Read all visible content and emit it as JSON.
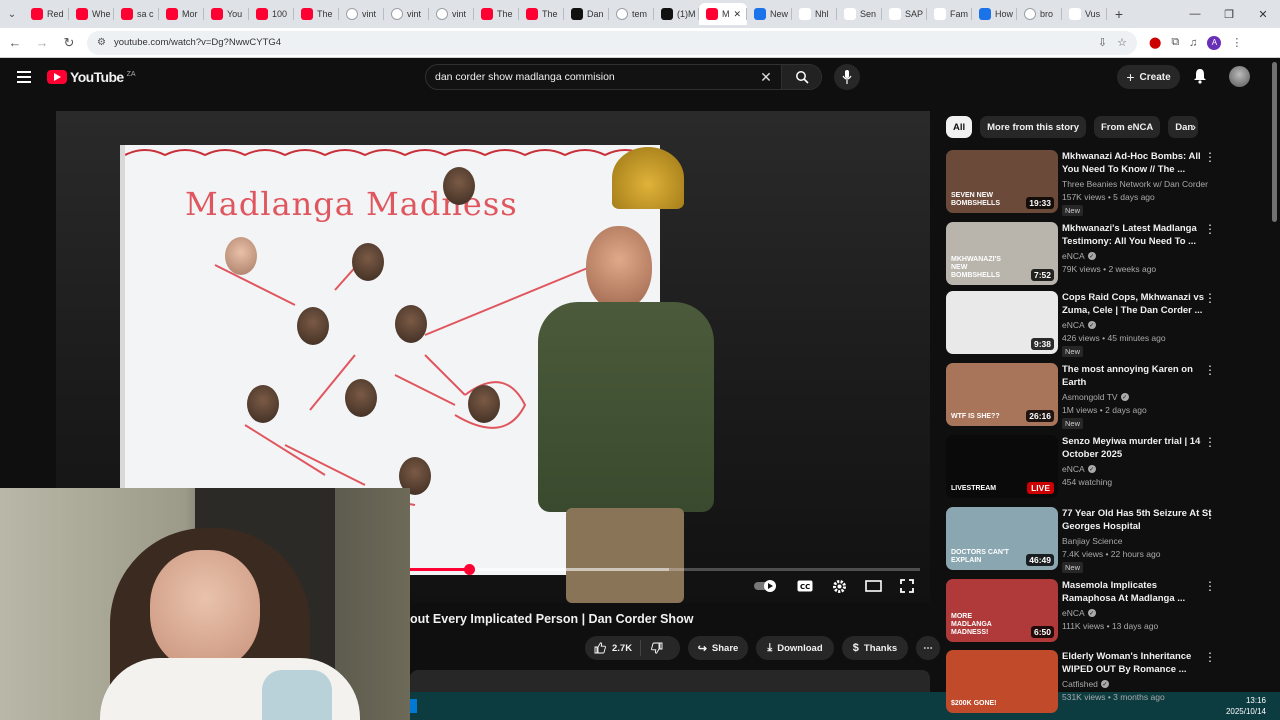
{
  "browser": {
    "tabs": [
      {
        "label": "Red",
        "icon": "yt"
      },
      {
        "label": "Whe",
        "icon": "yt"
      },
      {
        "label": "sa c",
        "icon": "yt"
      },
      {
        "label": "Mor",
        "icon": "yt"
      },
      {
        "label": "You",
        "icon": "yt"
      },
      {
        "label": "100",
        "icon": "yt"
      },
      {
        "label": "The",
        "icon": "yt"
      },
      {
        "label": "vint",
        "icon": "g"
      },
      {
        "label": "vint",
        "icon": "g"
      },
      {
        "label": "vint",
        "icon": "g"
      },
      {
        "label": "The",
        "icon": "yt"
      },
      {
        "label": "The",
        "icon": "yt"
      },
      {
        "label": "Dan",
        "icon": "tt"
      },
      {
        "label": "tem",
        "icon": "g"
      },
      {
        "label": "(1)M",
        "icon": "tt"
      },
      {
        "label": "M",
        "icon": "yt",
        "active": true
      },
      {
        "label": "New",
        "icon": "b"
      },
      {
        "label": "Nhl",
        "icon": "w"
      },
      {
        "label": "Sen",
        "icon": "w"
      },
      {
        "label": "SAP",
        "icon": "i"
      },
      {
        "label": "Fam",
        "icon": "w"
      },
      {
        "label": "How",
        "icon": "b"
      },
      {
        "label": "bro",
        "icon": "g"
      },
      {
        "label": "Vus",
        "icon": "w"
      }
    ],
    "url": "youtube.com/watch?v=Dg?NwwCYTG4",
    "profile_initial": "A"
  },
  "youtube": {
    "logo_text": "YouTube",
    "country_code": "ZA",
    "search_query": "dan corder show madlanga commision",
    "create_label": "Create"
  },
  "player": {
    "board_title": "Madlanga Madness",
    "progress_fraction": 0.12,
    "buffered_fraction": 0.51
  },
  "video": {
    "title": "out Every Implicated Person | Dan Corder Show",
    "likes": "2.7K",
    "share_label": "Share",
    "download_label": "Download",
    "thanks_label": "Thanks"
  },
  "chips": [
    "All",
    "More from this story",
    "From eNCA",
    "Dan"
  ],
  "recommendations": [
    {
      "title": "Mkhwanazi Ad-Hoc Bombs: All You Need To Know // The ...",
      "channel": "Three Beanies Network w/ Dan Corder",
      "verified": false,
      "meta": "157K views • 5 days ago",
      "badge": "New",
      "duration": "19:33",
      "thumb_caption": "SEVEN NEW BOMBSHELLS",
      "thumb_color": "#6b4a3a"
    },
    {
      "title": "Mkhwanazi's Latest Madlanga Testimony: All You Need To ...",
      "channel": "eNCA",
      "verified": true,
      "meta": "79K views • 2 weeks ago",
      "badge": "",
      "duration": "7:52",
      "thumb_caption": "MKHWANAZI'S NEW BOMBSHELLS",
      "thumb_color": "#b9b5ad"
    },
    {
      "title": "Cops Raid Cops, Mkhwanazi vs Zuma, Cele | The Dan Corder ...",
      "channel": "eNCA",
      "verified": true,
      "meta": "426 views • 45 minutes ago",
      "badge": "New",
      "duration": "9:38",
      "thumb_caption": "",
      "thumb_color": "#e9e9ea"
    },
    {
      "title": "The most annoying Karen on Earth",
      "channel": "Asmongold TV",
      "verified": true,
      "meta": "1M views • 2 days ago",
      "badge": "New",
      "duration": "26:16",
      "thumb_caption": "WTF is she??",
      "thumb_color": "#a8745a"
    },
    {
      "title": "Senzo Meyiwa murder trial | 14 October 2025",
      "channel": "eNCA",
      "verified": true,
      "meta": "454 watching",
      "badge": "",
      "duration": "",
      "live": "LIVE",
      "thumb_caption": "LIVESTREAM",
      "thumb_color": "#0a0a0a"
    },
    {
      "title": "77 Year Old Has 5th Seizure At St Georges Hospital",
      "channel": "Banjiay Science",
      "verified": false,
      "meta": "7.4K views • 22 hours ago",
      "badge": "New",
      "duration": "46:49",
      "thumb_caption": "DOCTORS CAN'T EXPLAIN",
      "thumb_color": "#8aa6b0"
    },
    {
      "title": "Masemola Implicates Ramaphosa At Madlanga ...",
      "channel": "eNCA",
      "verified": true,
      "meta": "111K views • 13 days ago",
      "badge": "",
      "duration": "6:50",
      "thumb_caption": "MORE MADLANGA MADNESS!",
      "thumb_color": "#b03a3a"
    },
    {
      "title": "Elderly Woman's Inheritance WIPED OUT By Romance ...",
      "channel": "Catfished",
      "verified": true,
      "meta": "531K views • 3 months ago",
      "badge": "",
      "duration": "",
      "thumb_caption": "$200K GONE!",
      "thumb_color": "#c04a2a"
    }
  ],
  "taskbar": {
    "time": "13:16",
    "date": "2025/10/14"
  }
}
